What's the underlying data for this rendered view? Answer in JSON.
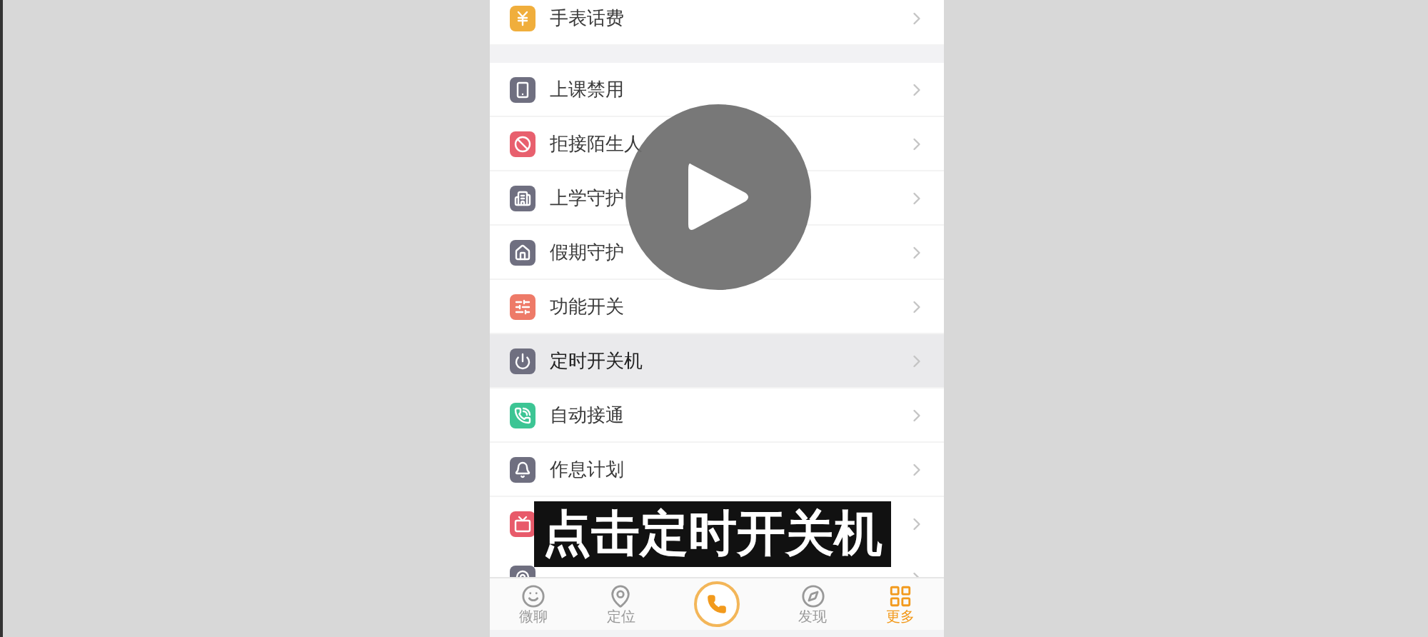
{
  "menu_groups": [
    {
      "items": [
        {
          "label": "手表话费",
          "color": "#f0ae3c",
          "selected": false
        }
      ]
    },
    {
      "items": [
        {
          "label": "上课禁用",
          "color": "#6f6f80",
          "selected": false
        },
        {
          "label": "拒接陌生人",
          "color": "#e8606e",
          "selected": false
        },
        {
          "label": "上学守护",
          "color": "#6f6f80",
          "selected": false
        },
        {
          "label": "假期守护",
          "color": "#6f6f80",
          "selected": false
        },
        {
          "label": "功能开关",
          "color": "#ee7a68",
          "selected": false
        },
        {
          "label": "定时开关机",
          "color": "#6f6f80",
          "selected": true
        },
        {
          "label": "自动接通",
          "color": "#3cc594",
          "selected": false
        },
        {
          "label": "作息计划",
          "color": "#6f6f80",
          "selected": false
        },
        {
          "color": "#e85a6a"
        },
        {
          "color": "#6f6f80"
        }
      ]
    }
  ],
  "caption": "点击定时开关机",
  "tab_bar": [
    {
      "kind": "tab",
      "label": "微聊",
      "selected": false
    },
    {
      "kind": "tab",
      "label": "定位",
      "selected": false
    },
    {
      "kind": "call"
    },
    {
      "kind": "tab",
      "label": "发现",
      "selected": false
    },
    {
      "kind": "tab",
      "label": "更多",
      "selected": true
    }
  ]
}
